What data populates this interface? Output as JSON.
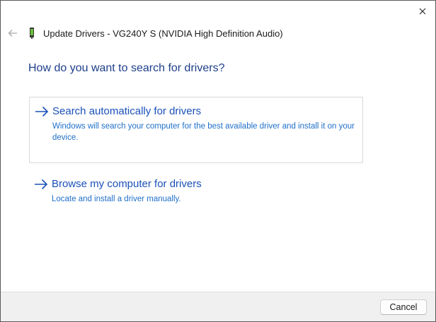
{
  "window": {
    "title": "Update Drivers - VG240Y S (NVIDIA High Definition Audio)",
    "close_icon": "close-icon",
    "back_icon": "back-arrow-icon",
    "device_icon": "device-icon"
  },
  "main": {
    "question": "How do you want to search for drivers?",
    "options": [
      {
        "title": "Search automatically for drivers",
        "description": "Windows will search your computer for the best available driver and install it on your device.",
        "icon": "arrow-right-icon",
        "selected": true
      },
      {
        "title": "Browse my computer for drivers",
        "description": "Locate and install a driver manually.",
        "icon": "arrow-right-icon",
        "selected": false
      }
    ]
  },
  "footer": {
    "cancel_label": "Cancel"
  },
  "colors": {
    "heading": "#1e3f8a",
    "option_title": "#1a50b8",
    "option_desc": "#1f6fc8",
    "footer_bg": "#f0f0f0"
  }
}
